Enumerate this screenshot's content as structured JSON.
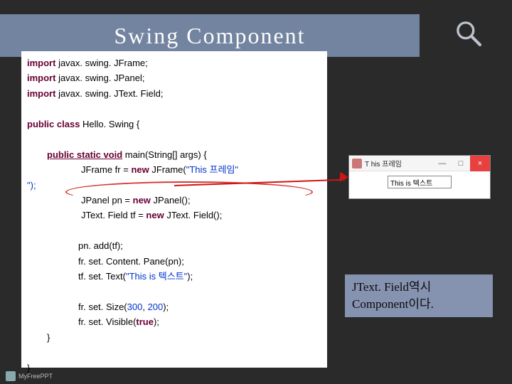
{
  "title": "Swing Component",
  "code": {
    "imports": [
      {
        "kw": "import",
        "pkg": " javax. swing. JFrame;"
      },
      {
        "kw": "import",
        "pkg": " javax. swing. JPanel;"
      },
      {
        "kw": "import",
        "pkg": " javax. swing. JText. Field;"
      }
    ],
    "class_kw": "public class",
    "class_name": " Hello. Swing {",
    "method_kw": "public static void",
    "method_sig": " main(String[] args) {",
    "line_jframe_pre": "JFrame fr = ",
    "new_kw": "new",
    "line_jframe_post": " JFrame(",
    "str_frame": "\"This 프레임\"",
    "close_paren": ");",
    "hang_close": "\");",
    "line_jpanel_pre": "JPanel pn = ",
    "line_jpanel_post": " JPanel();",
    "line_jtext_pre": "JText. Field tf = ",
    "line_jtext_post": " JText. Field();",
    "line_add": "pn. add(tf);",
    "line_content": "fr. set. Content. Pane(pn);",
    "line_settext_pre": "tf. set. Text(",
    "str_text": "\"This is 텍스트\"",
    "line_size_pre": "fr. set. Size(",
    "num_w": "300",
    "comma": ", ",
    "num_h": "200",
    "line_vis_pre": "fr. set. Visible(",
    "bool_true": "true",
    "close_brace": "}"
  },
  "window": {
    "title": "T his 프레임",
    "min": "—",
    "max": "□",
    "close": "×",
    "input_value": "This is 텍스트"
  },
  "callout": {
    "line1": "JText. Field역시",
    "line2": "Component이다."
  },
  "footer": "MyFreePPT"
}
